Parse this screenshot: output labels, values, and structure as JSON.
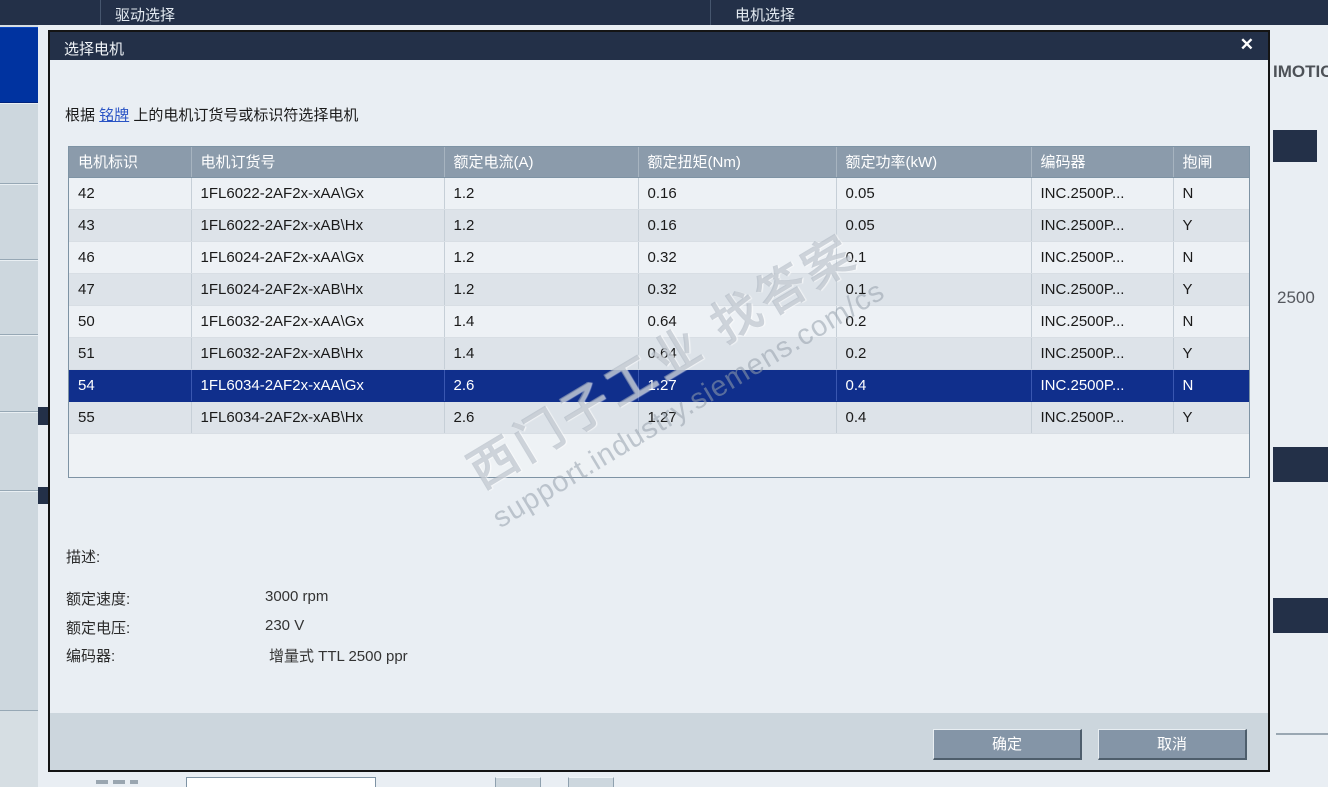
{
  "colors": {
    "titlebar_bg": "#233048",
    "selected_row_bg": "#102F8C",
    "table_header_bg": "#8B9BAB",
    "nav_selected_blue": "#0033A0"
  },
  "background": {
    "top_bar": {
      "left_label": "驱动选择",
      "right_label": "电机选择"
    },
    "right_panel": {
      "simotics_text": "IMOTIC",
      "value_2500": "2500"
    }
  },
  "dialog": {
    "title": "选择电机",
    "close_icon": "✕",
    "intro": {
      "prefix": "根据 ",
      "link": "铭牌",
      "suffix": " 上的电机订货号或标识符选择电机"
    },
    "table": {
      "headers": [
        "电机标识",
        "电机订货号",
        "额定电流(A)",
        "额定扭矩(Nm)",
        "额定功率(kW)",
        "编码器",
        "抱闸"
      ],
      "rows": [
        [
          "42",
          "1FL6022-2AF2x-xAA\\Gx",
          "1.2",
          "0.16",
          "0.05",
          "INC.2500P...",
          "N"
        ],
        [
          "43",
          "1FL6022-2AF2x-xAB\\Hx",
          "1.2",
          "0.16",
          "0.05",
          "INC.2500P...",
          "Y"
        ],
        [
          "46",
          "1FL6024-2AF2x-xAA\\Gx",
          "1.2",
          "0.32",
          "0.1",
          "INC.2500P...",
          "N"
        ],
        [
          "47",
          "1FL6024-2AF2x-xAB\\Hx",
          "1.2",
          "0.32",
          "0.1",
          "INC.2500P...",
          "Y"
        ],
        [
          "50",
          "1FL6032-2AF2x-xAA\\Gx",
          "1.4",
          "0.64",
          "0.2",
          "INC.2500P...",
          "N"
        ],
        [
          "51",
          "1FL6032-2AF2x-xAB\\Hx",
          "1.4",
          "0.64",
          "0.2",
          "INC.2500P...",
          "Y"
        ],
        [
          "54",
          "1FL6034-2AF2x-xAA\\Gx",
          "2.6",
          "1.27",
          "0.4",
          "INC.2500P...",
          "N"
        ],
        [
          "55",
          "1FL6034-2AF2x-xAB\\Hx",
          "2.6",
          "1.27",
          "0.4",
          "INC.2500P...",
          "Y"
        ]
      ],
      "selected_index": 6
    },
    "description": {
      "label": "描述:",
      "fields": [
        {
          "label": "额定速度:",
          "value": "3000 rpm"
        },
        {
          "label": "额定电压:",
          "value": "230 V"
        },
        {
          "label": "编码器:",
          "value": "增量式 TTL 2500 ppr"
        }
      ]
    },
    "buttons": {
      "ok": "确定",
      "cancel": "取消"
    }
  },
  "watermark": {
    "line1": "西门子工业 找答案",
    "line2": "support.industry.siemens.com/cs"
  }
}
